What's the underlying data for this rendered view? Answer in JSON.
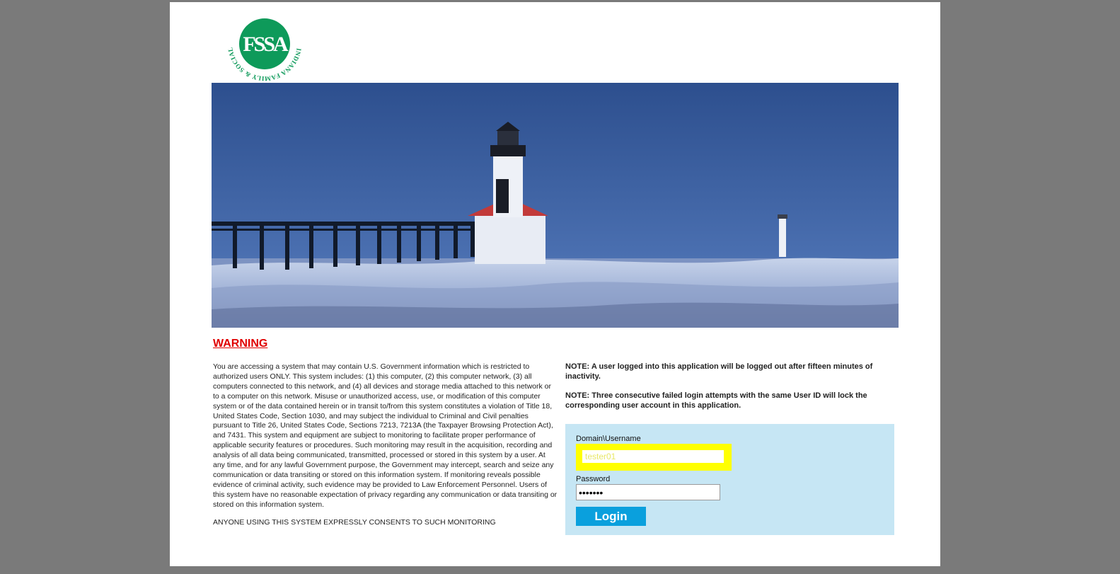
{
  "logo": {
    "initials": "FSSA",
    "ring_text": "INDIANA FAMILY & SOCIAL SERVICES ADMINISTRATION",
    "brand_color": "#0e9a5a"
  },
  "warning": {
    "title": "WARNING",
    "body": "You are accessing a system that may contain U.S. Government information which is restricted to authorized users ONLY. This system includes: (1) this computer, (2) this computer network, (3) all computers connected to this network, and (4) all devices and storage media attached to this network or to a computer on this network. Misuse or unauthorized access, use, or modification of this computer system or of the data contained herein or in transit to/from this system constitutes a violation of Title 18, United States Code, Section 1030, and may subject the individual to Criminal and Civil penalties pursuant to Title 26, United States Code, Sections 7213, 7213A (the Taxpayer Browsing Protection Act), and 7431. This system and equipment are subject to monitoring to facilitate proper performance of applicable security features or procedures. Such monitoring may result in the acquisition, recording and analysis of all data being communicated, transmitted, processed or stored in this system by a user. At any time, and for any lawful Government purpose, the Government may intercept, search and seize any communication or data transiting or stored on this information system. If monitoring reveals possible evidence of criminal activity, such evidence may be provided to Law Enforcement Personnel. Users of this system have no reasonable expectation of privacy regarding any communication or data transiting or stored on this information system.",
    "consent": "ANYONE USING THIS SYSTEM EXPRESSLY CONSENTS TO SUCH MONITORING"
  },
  "notes": {
    "timeout": "NOTE: A user logged into this application will be logged out after fifteen minutes of inactivity.",
    "lockout": "NOTE: Three consecutive failed login attempts with the same User ID will lock the corresponding user account in this application."
  },
  "login": {
    "username_label": "Domain\\Username",
    "username_value": "tester01",
    "password_label": "Password",
    "password_value": "•••••••",
    "button_label": "Login"
  },
  "colors": {
    "warning_red": "#e00000",
    "panel_bg": "#c6e6f4",
    "highlight": "#ffff00",
    "button": "#0aa0dd"
  }
}
